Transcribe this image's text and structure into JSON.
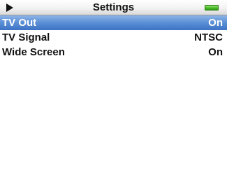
{
  "header": {
    "title": "Settings",
    "play_icon": "play-icon",
    "battery_icon": "battery-full-icon",
    "battery_color": "#4fbf2c"
  },
  "menu": {
    "items": [
      {
        "label": "TV Out",
        "value": "On",
        "selected": true
      },
      {
        "label": "TV Signal",
        "value": "NTSC",
        "selected": false
      },
      {
        "label": "Wide Screen",
        "value": "On",
        "selected": false
      }
    ]
  },
  "colors": {
    "selection": "#5a8ed6",
    "background": "#ffffff",
    "text": "#111111"
  }
}
